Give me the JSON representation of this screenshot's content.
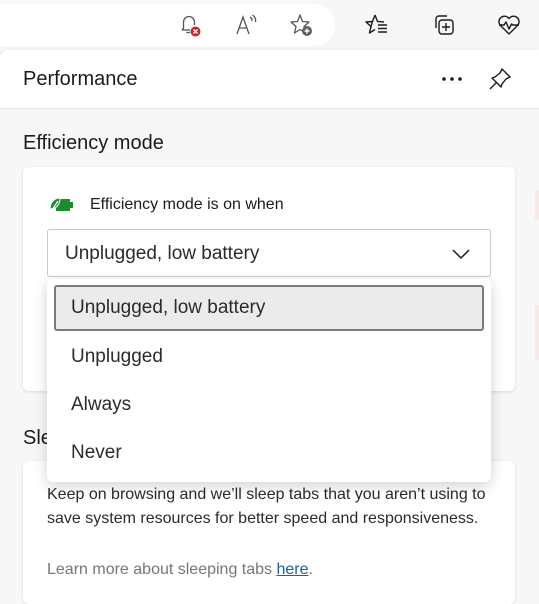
{
  "toolbar": {
    "icons": [
      {
        "name": "notifications-blocked-icon"
      },
      {
        "name": "read-aloud-icon"
      },
      {
        "name": "add-favorite-icon"
      },
      {
        "name": "favorites-icon"
      },
      {
        "name": "collections-icon"
      },
      {
        "name": "performance-icon"
      }
    ]
  },
  "panel": {
    "title": "Performance",
    "more_icon": "more-options-icon",
    "pin_icon": "pin-icon"
  },
  "efficiency": {
    "section_title": "Efficiency mode",
    "label": "Efficiency mode is on when",
    "selected_value": "Unplugged, low battery",
    "options": [
      {
        "label": "Unplugged, low battery",
        "selected": true
      },
      {
        "label": "Unplugged",
        "selected": false
      },
      {
        "label": "Always",
        "selected": false
      },
      {
        "label": "Never",
        "selected": false
      }
    ],
    "accent_color": "#1e8a2e"
  },
  "sleeping_tabs": {
    "section_title_partial": "Sle",
    "description": "Keep on browsing and we’ll sleep tabs that you aren’t using to save system resources for better speed and responsiveness.",
    "learn_more_prefix": "Learn more about sleeping tabs ",
    "learn_more_link": "here",
    "learn_more_suffix": ".",
    "link_color": "#1a5fa8"
  }
}
